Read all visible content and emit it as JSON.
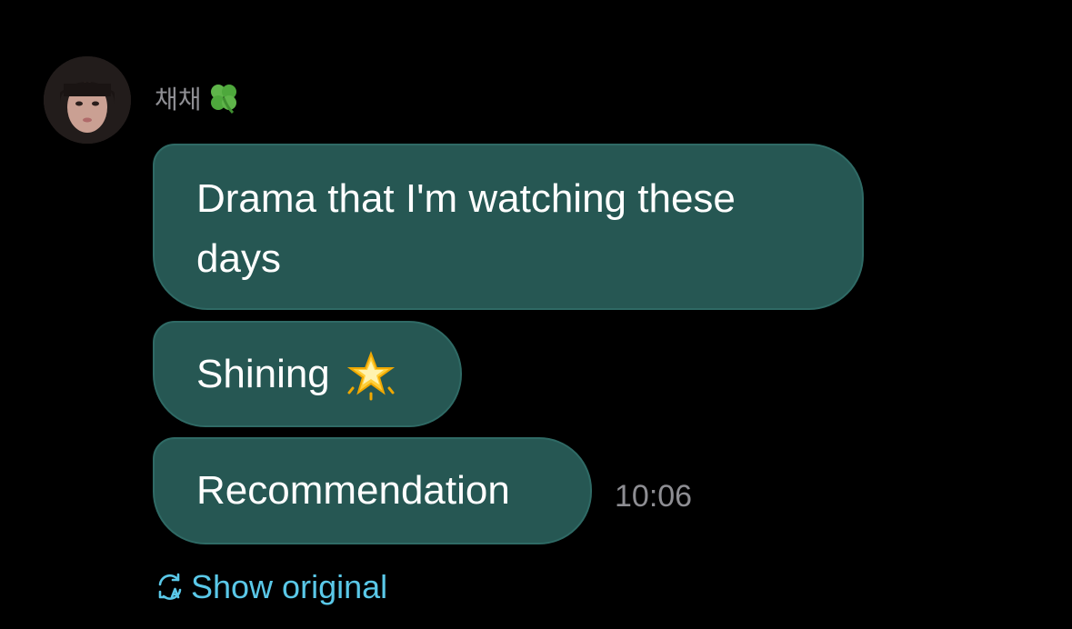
{
  "sender": {
    "name": "채채",
    "emoji_icon": "four-leaf-clover-icon"
  },
  "messages": [
    {
      "text": "Drama that I'm watching these days"
    },
    {
      "text": "Shining",
      "emoji_icon": "glowing-star-icon"
    },
    {
      "text": "Recommendation"
    }
  ],
  "timestamp": "10:06",
  "show_original": {
    "label": "Show original",
    "icon": "translate-refresh-icon"
  },
  "colors": {
    "background": "#000000",
    "bubble": "#265753",
    "link": "#5ac8e8",
    "muted": "#8e8e93"
  }
}
